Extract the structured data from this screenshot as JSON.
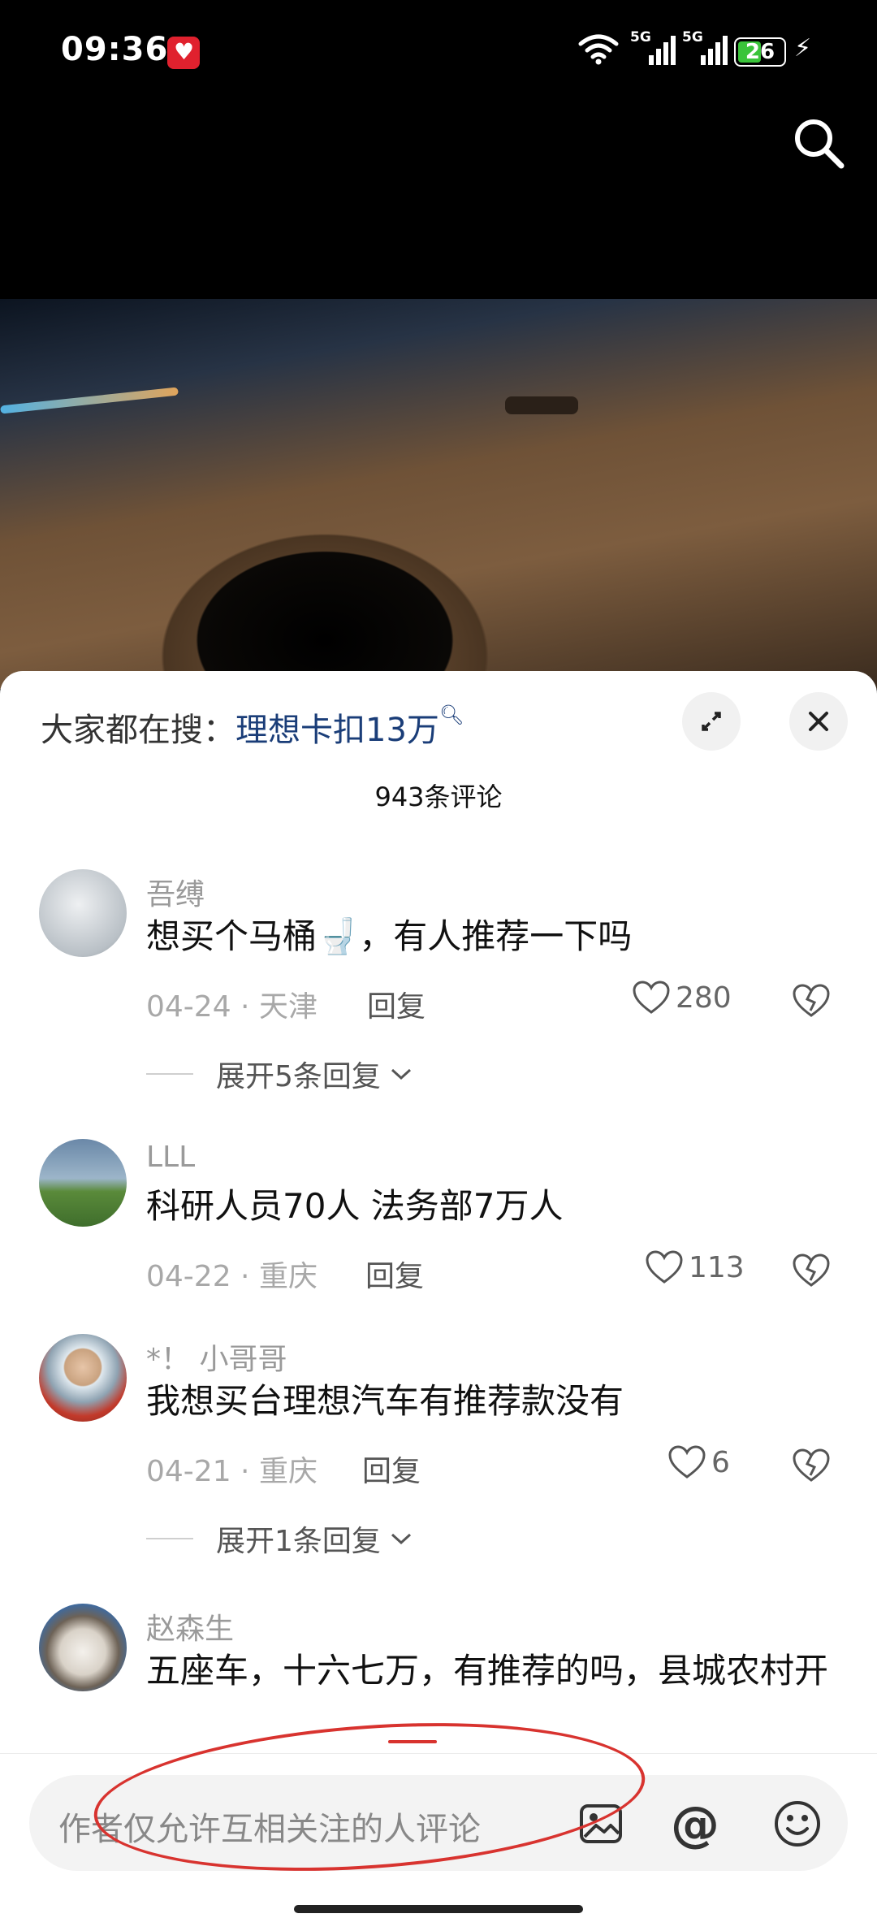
{
  "status_bar": {
    "time": "09:36",
    "network_1": "5G",
    "network_2": "5G",
    "battery": "26"
  },
  "search": {
    "hot_label": "大家都在搜：",
    "hot_keyword": "理想卡扣13万"
  },
  "comments_count": "943条评论",
  "comments": [
    {
      "user": "吾缚",
      "text": "想买个马桶🚽，有人推荐一下吗",
      "date_loc": "04-24 · 天津",
      "reply": "回复",
      "likes": "280",
      "expand": "展开5条回复"
    },
    {
      "user": "LLL",
      "text": "科研人员70人 法务部7万人",
      "date_loc": "04-22 · 重庆",
      "reply": "回复",
      "likes": "113"
    },
    {
      "user": "*！ 小哥哥",
      "text": "我想买台理想汽车有推荐款没有",
      "date_loc": "04-21 · 重庆",
      "reply": "回复",
      "likes": "6",
      "expand": "展开1条回复"
    },
    {
      "user": "赵森生",
      "text": "五座车，十六七万，有推荐的吗，县城农村开"
    }
  ],
  "input": {
    "placeholder": "作者仅允许互相关注的人评论",
    "at": "@"
  },
  "colors": {
    "accent_link": "#1a3d78",
    "annotation": "#d8332f",
    "battery": "#3ac43a"
  }
}
